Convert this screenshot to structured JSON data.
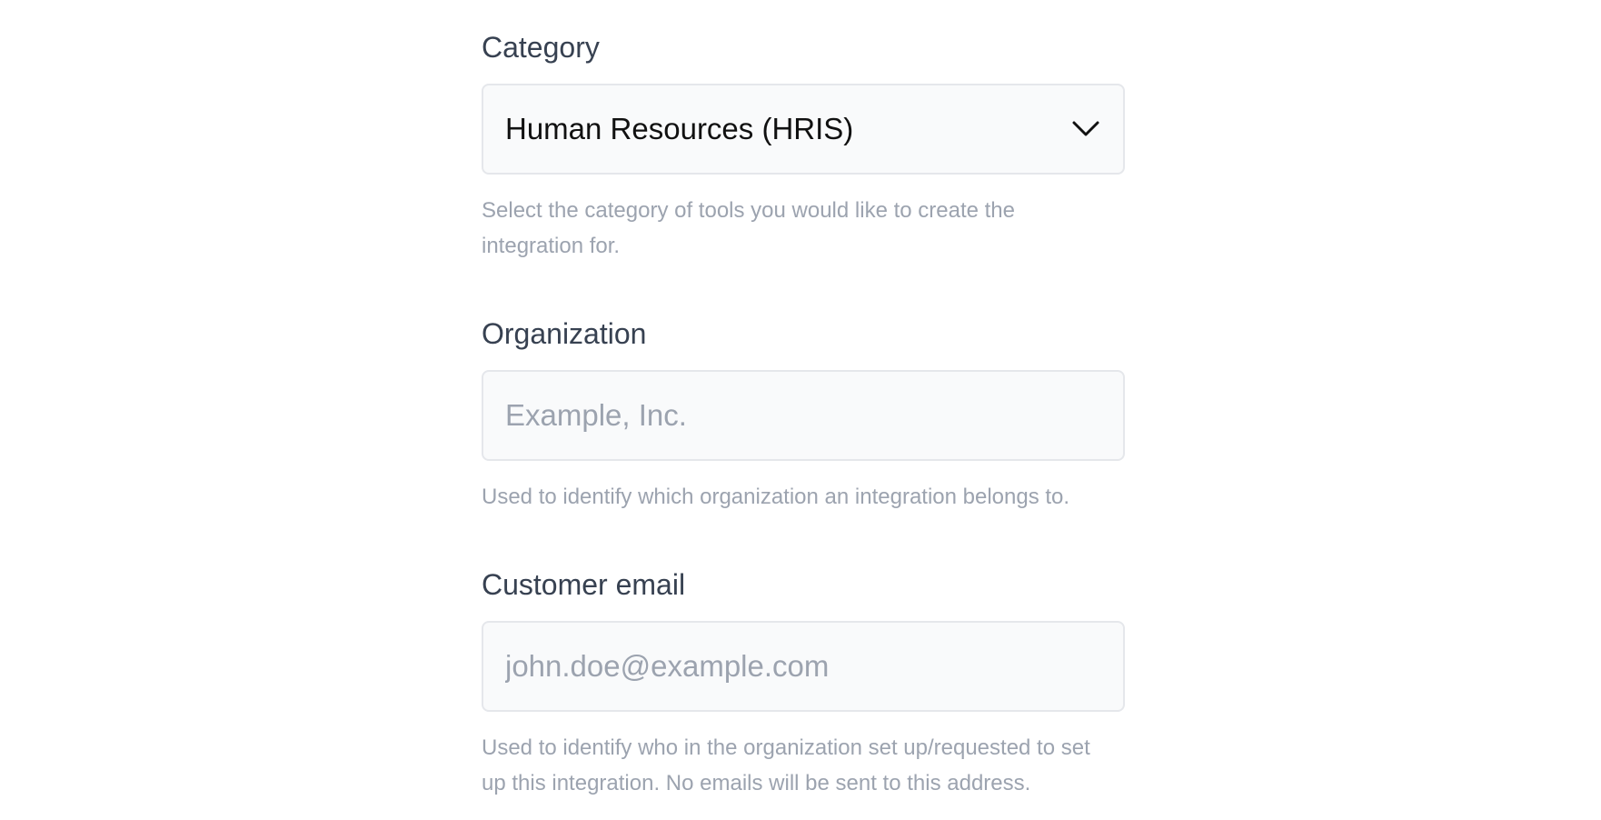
{
  "form": {
    "category": {
      "label": "Category",
      "selected_value": "Human Resources (HRIS)",
      "help": "Select the category of tools you would like to create the integration for.",
      "icon": "chevron-down-icon"
    },
    "organization": {
      "label": "Organization",
      "value": "",
      "placeholder": "Example, Inc.",
      "help": "Used to identify which organization an integration belongs to."
    },
    "customer_email": {
      "label": "Customer email",
      "value": "",
      "placeholder": "john.doe@example.com",
      "help": "Used to identify who in the organization set up/requested to set up this integration. No emails will be sent to this address."
    }
  },
  "colors": {
    "label": "#374151",
    "help_text": "#9ca3af",
    "field_background": "#f9fafb",
    "field_border": "#e5e7eb"
  }
}
